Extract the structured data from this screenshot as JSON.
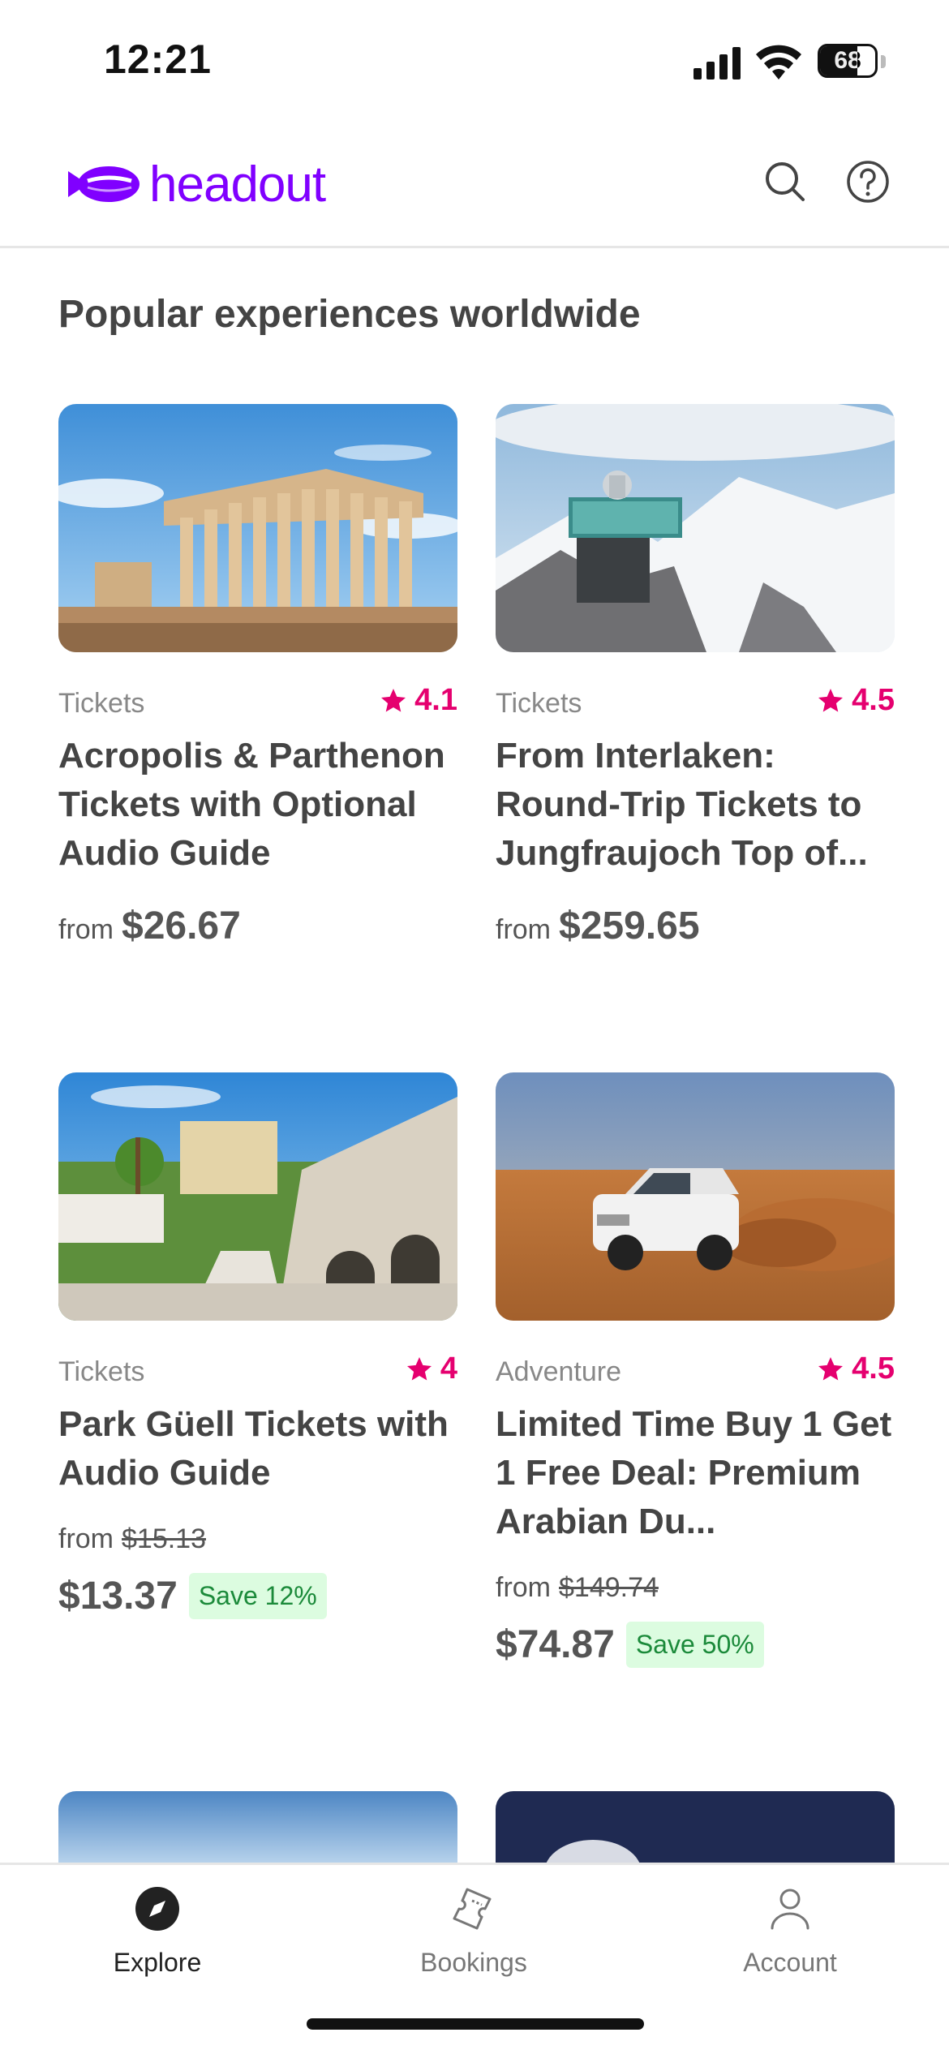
{
  "status_bar": {
    "time": "12:21",
    "battery": "68",
    "battery_level": 0.68
  },
  "header": {
    "logo_text": "headout",
    "brand_color": "#8000ff"
  },
  "section": {
    "title": "Popular experiences worldwide"
  },
  "cards": [
    {
      "category": "Tickets",
      "rating": "4.1",
      "title": "Acropolis & Parthenon Tickets with Optional Audio Guide",
      "from_label": "from",
      "price": "$26.67"
    },
    {
      "category": "Tickets",
      "rating": "4.5",
      "title": "From Interlaken: Round-Trip Tickets to Jungfraujoch Top of...",
      "from_label": "from",
      "price": "$259.65"
    },
    {
      "category": "Tickets",
      "rating": "4",
      "title": "Park Güell Tickets with Audio Guide",
      "from_label": "from",
      "original_price": "$15.13",
      "price": "$13.37",
      "save": "Save 12%"
    },
    {
      "category": "Adventure",
      "rating": "4.5",
      "title": "Limited Time Buy 1 Get 1 Free Deal: Premium Arabian Du...",
      "from_label": "from",
      "original_price": "$149.74",
      "price": "$74.87",
      "save": "Save 50%"
    }
  ],
  "bottom_nav": {
    "items": [
      {
        "label": "Explore",
        "icon": "compass-icon",
        "active": true
      },
      {
        "label": "Bookings",
        "icon": "ticket-icon",
        "active": false
      },
      {
        "label": "Account",
        "icon": "person-icon",
        "active": false
      }
    ]
  },
  "colors": {
    "rating": "#e5006f",
    "save_bg": "#dcfce0",
    "save_text": "#1b8a3a"
  }
}
